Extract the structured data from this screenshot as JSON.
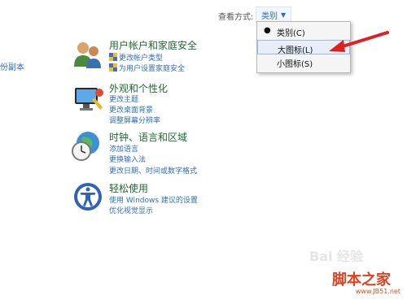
{
  "left_fragment": "份副本",
  "view_by": {
    "label": "查看方式:",
    "selected": "类别"
  },
  "menu": {
    "items": [
      {
        "label": "类别(C)",
        "selected": true
      },
      {
        "label": "大图标(L)",
        "selected": false
      },
      {
        "label": "小图标(S)",
        "selected": false
      }
    ]
  },
  "categories": [
    {
      "title": "用户帐户和家庭安全",
      "links": [
        "更改帐户类型",
        "为用户设置家庭安全"
      ]
    },
    {
      "title": "外观和个性化",
      "links": [
        "更改主题",
        "更改桌面背景",
        "调整屏幕分辨率"
      ]
    },
    {
      "title": "时钟、语言和区域",
      "links": [
        "添加语言",
        "更换输入法",
        "更改日期、时间或数字格式"
      ]
    },
    {
      "title": "轻松使用",
      "links": [
        "使用 Windows 建议的设置",
        "优化视觉显示"
      ]
    }
  ],
  "watermark": {
    "logo": "脚本之家",
    "url": "www.JB51.net"
  },
  "colors": {
    "link": "#2f6fb5",
    "category_title": "#1f6a2e",
    "arrow": "#e02020"
  }
}
